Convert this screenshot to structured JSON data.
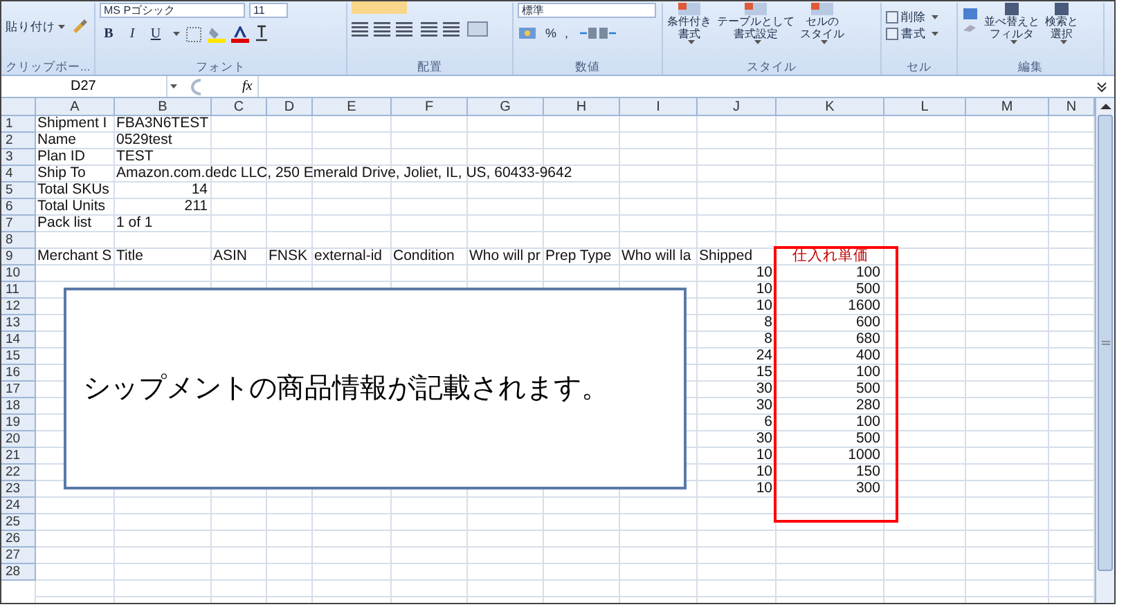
{
  "ribbon": {
    "font_name": "MS Pゴシック",
    "font_size": "11",
    "number_format": "標準",
    "paste_label": "貼り付け",
    "format_buttons": [
      "B",
      "I",
      "U"
    ],
    "number_buttons": [
      "%",
      ","
    ],
    "style_buttons": [
      {
        "lines": [
          "条件付き",
          "書式"
        ]
      },
      {
        "lines": [
          "テーブルとして",
          "書式設定"
        ]
      },
      {
        "lines": [
          "セルの",
          "スタイル"
        ]
      }
    ],
    "cell_buttons": [
      "削除",
      "書式"
    ],
    "edit_buttons": [
      {
        "lines": [
          "並べ替えと",
          "フィルタ"
        ]
      },
      {
        "lines": [
          "検索と",
          "選択"
        ]
      }
    ],
    "group_labels": [
      "クリップボー...",
      "フォント",
      "配置",
      "数値",
      "スタイル",
      "セル",
      "編集"
    ]
  },
  "formula_bar": {
    "name_box": "D27",
    "fx_label": "fx"
  },
  "sheet": {
    "columns": [
      "A",
      "B",
      "C",
      "D",
      "E",
      "F",
      "G",
      "H",
      "I",
      "J",
      "K",
      "L",
      "M",
      "N"
    ],
    "rows": [
      {
        "number": "1",
        "cells": [
          {
            "text": "Shipment I"
          },
          {
            "text": "FBA3N6TEST"
          }
        ]
      },
      {
        "number": "2",
        "cells": [
          {
            "text": "Name"
          },
          {
            "text": "0529test"
          }
        ]
      },
      {
        "number": "3",
        "cells": [
          {
            "text": "Plan ID"
          },
          {
            "text": "TEST"
          }
        ]
      },
      {
        "number": "4",
        "cells": [
          {
            "text": "Ship To"
          },
          {
            "text": "Amazon.com.dedc LLC, 250 Emerald Drive, Joliet, IL, US, 60433-9642"
          }
        ]
      },
      {
        "number": "5",
        "cells": [
          {
            "text": "Total SKUs"
          },
          {
            "text": "14",
            "kind": "number"
          }
        ]
      },
      {
        "number": "6",
        "cells": [
          {
            "text": "Total Units"
          },
          {
            "text": "211",
            "kind": "number"
          }
        ]
      },
      {
        "number": "7",
        "cells": [
          {
            "text": "Pack list"
          },
          {
            "text": "1 of 1"
          }
        ]
      },
      {
        "number": "8",
        "cells": []
      },
      {
        "number": "9",
        "cells": [
          {
            "text": "Merchant S"
          },
          {
            "text": "Title"
          },
          {
            "text": "ASIN"
          },
          {
            "text": "FNSK"
          },
          {
            "text": "external-id"
          },
          {
            "text": "Condition"
          },
          {
            "text": "Who will pr"
          },
          {
            "text": "Prep Type"
          },
          {
            "text": "Who will la"
          },
          {
            "text": "Shipped"
          },
          {
            "text": "仕入れ単価",
            "kind": "highlighted"
          }
        ]
      },
      {
        "number": "10",
        "cells": [
          null,
          null,
          null,
          null,
          null,
          null,
          null,
          null,
          null,
          {
            "text": "10",
            "kind": "number"
          },
          {
            "text": "100",
            "kind": "number"
          }
        ]
      },
      {
        "number": "11",
        "cells": [
          null,
          null,
          null,
          null,
          null,
          null,
          null,
          null,
          null,
          {
            "text": "10",
            "kind": "number"
          },
          {
            "text": "500",
            "kind": "number"
          }
        ]
      },
      {
        "number": "12",
        "cells": [
          null,
          null,
          null,
          null,
          null,
          null,
          null,
          null,
          null,
          {
            "text": "10",
            "kind": "number"
          },
          {
            "text": "1600",
            "kind": "number"
          }
        ]
      },
      {
        "number": "13",
        "cells": [
          null,
          null,
          null,
          null,
          null,
          null,
          null,
          null,
          null,
          {
            "text": "8",
            "kind": "number"
          },
          {
            "text": "600",
            "kind": "number"
          }
        ]
      },
      {
        "number": "14",
        "cells": [
          null,
          null,
          null,
          null,
          null,
          null,
          null,
          null,
          null,
          {
            "text": "8",
            "kind": "number"
          },
          {
            "text": "680",
            "kind": "number"
          }
        ]
      },
      {
        "number": "15",
        "cells": [
          null,
          null,
          null,
          null,
          null,
          null,
          null,
          null,
          null,
          {
            "text": "24",
            "kind": "number"
          },
          {
            "text": "400",
            "kind": "number"
          }
        ]
      },
      {
        "number": "16",
        "cells": [
          null,
          null,
          null,
          null,
          null,
          null,
          null,
          null,
          null,
          {
            "text": "15",
            "kind": "number"
          },
          {
            "text": "100",
            "kind": "number"
          }
        ]
      },
      {
        "number": "17",
        "cells": [
          null,
          null,
          null,
          null,
          null,
          null,
          null,
          null,
          null,
          {
            "text": "30",
            "kind": "number"
          },
          {
            "text": "500",
            "kind": "number"
          }
        ]
      },
      {
        "number": "18",
        "cells": [
          null,
          null,
          null,
          null,
          null,
          null,
          null,
          null,
          null,
          {
            "text": "30",
            "kind": "number"
          },
          {
            "text": "280",
            "kind": "number"
          }
        ]
      },
      {
        "number": "19",
        "cells": [
          null,
          null,
          null,
          null,
          null,
          null,
          null,
          null,
          null,
          {
            "text": "6",
            "kind": "number"
          },
          {
            "text": "100",
            "kind": "number"
          }
        ]
      },
      {
        "number": "20",
        "cells": [
          null,
          null,
          null,
          null,
          null,
          null,
          null,
          null,
          null,
          {
            "text": "30",
            "kind": "number"
          },
          {
            "text": "500",
            "kind": "number"
          }
        ]
      },
      {
        "number": "21",
        "cells": [
          null,
          null,
          null,
          null,
          null,
          null,
          null,
          null,
          null,
          {
            "text": "10",
            "kind": "number"
          },
          {
            "text": "1000",
            "kind": "number"
          }
        ]
      },
      {
        "number": "22",
        "cells": [
          null,
          null,
          null,
          null,
          null,
          null,
          null,
          null,
          null,
          {
            "text": "10",
            "kind": "number"
          },
          {
            "text": "150",
            "kind": "number"
          }
        ]
      },
      {
        "number": "23",
        "cells": [
          null,
          null,
          null,
          null,
          null,
          null,
          null,
          null,
          null,
          {
            "text": "10",
            "kind": "number"
          },
          {
            "text": "300",
            "kind": "number"
          }
        ]
      },
      {
        "number": "24",
        "cells": []
      },
      {
        "number": "25",
        "cells": []
      },
      {
        "number": "26",
        "cells": []
      },
      {
        "number": "27",
        "cells": []
      },
      {
        "number": "28",
        "cells": []
      }
    ]
  },
  "callout": {
    "text": "シップメントの商品情報が記載されます。"
  }
}
